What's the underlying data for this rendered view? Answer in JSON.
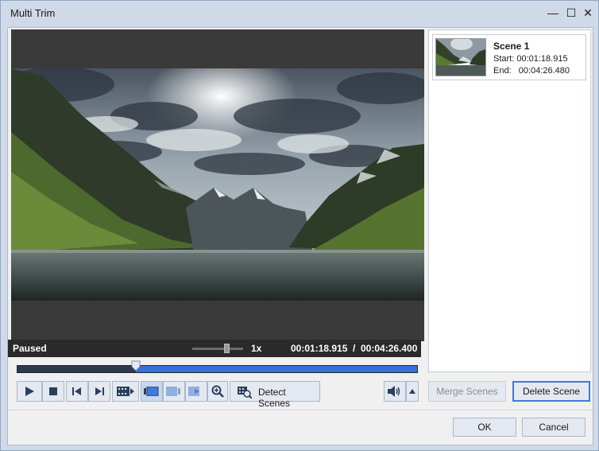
{
  "window": {
    "title": "Multi Trim"
  },
  "window_controls": {
    "minimize": "—",
    "maximize": "☐",
    "close": "✕"
  },
  "player": {
    "status": "Paused",
    "speed": "1x",
    "current_time": "00:01:18.915",
    "separator": "/",
    "total_time": "00:04:26.400",
    "playhead_fraction": 0.296
  },
  "controls": {
    "detect_scenes_label": "Detect Scenes"
  },
  "scenes": [
    {
      "name": "Scene 1",
      "start": "Start: 00:01:18.915",
      "end": "End:   00:04:26.480"
    }
  ],
  "buttons": {
    "merge_scenes": "Merge Scenes",
    "delete_scene": "Delete Scene",
    "ok": "OK",
    "cancel": "Cancel"
  },
  "colors": {
    "accent": "#3b6fd6",
    "window_bg": "#cfd9e8",
    "video_bg": "#3a3a3a",
    "status_bg": "#2a2a2a"
  }
}
